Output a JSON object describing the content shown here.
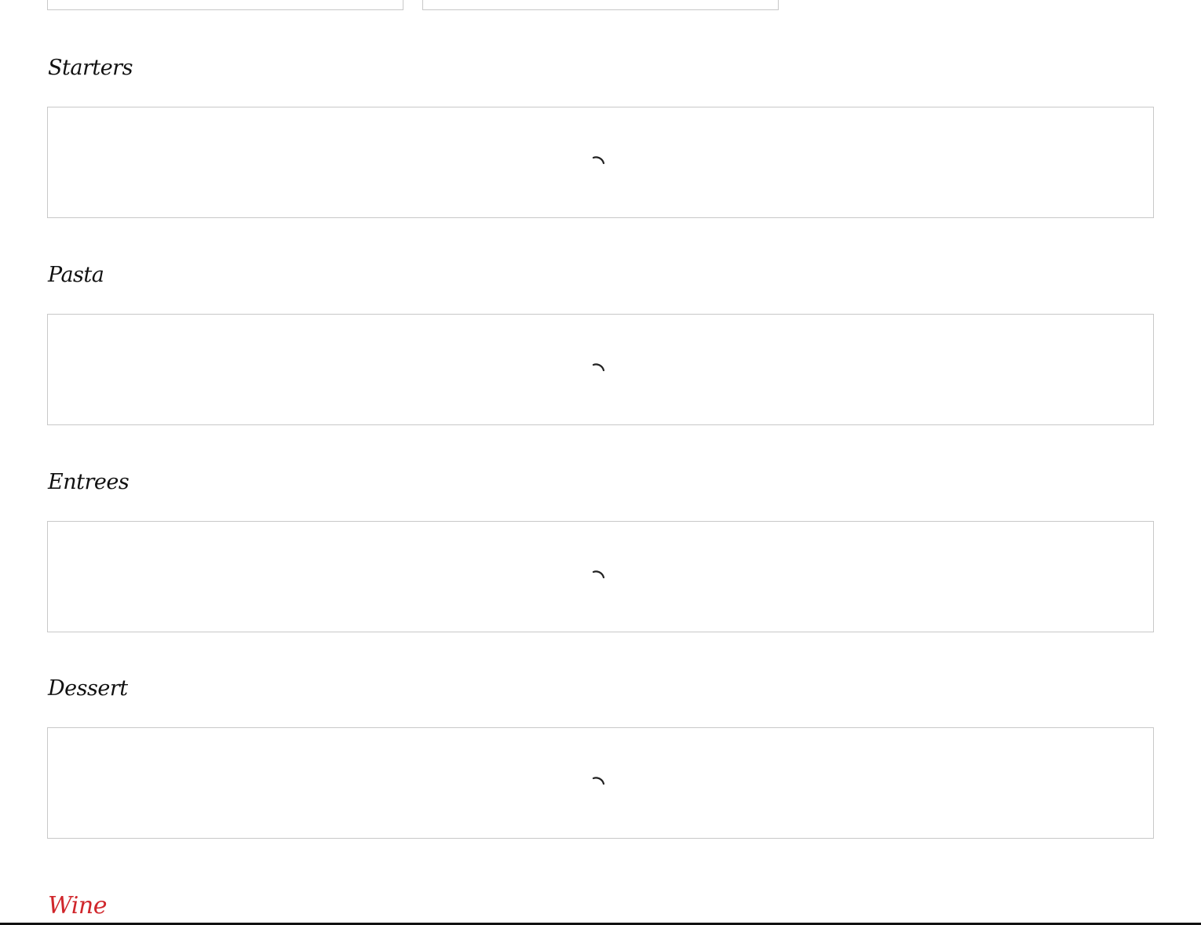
{
  "menu": {
    "sections": [
      {
        "title": "Starters"
      },
      {
        "title": "Pasta"
      },
      {
        "title": "Entrees"
      },
      {
        "title": "Dessert"
      }
    ],
    "next_section": {
      "title": "Wine"
    }
  },
  "colors": {
    "heading": "#111111",
    "accent": "#d0262b",
    "panel_border": "#c8c8c8"
  },
  "icons": {
    "loading": "loading-spinner-icon"
  }
}
